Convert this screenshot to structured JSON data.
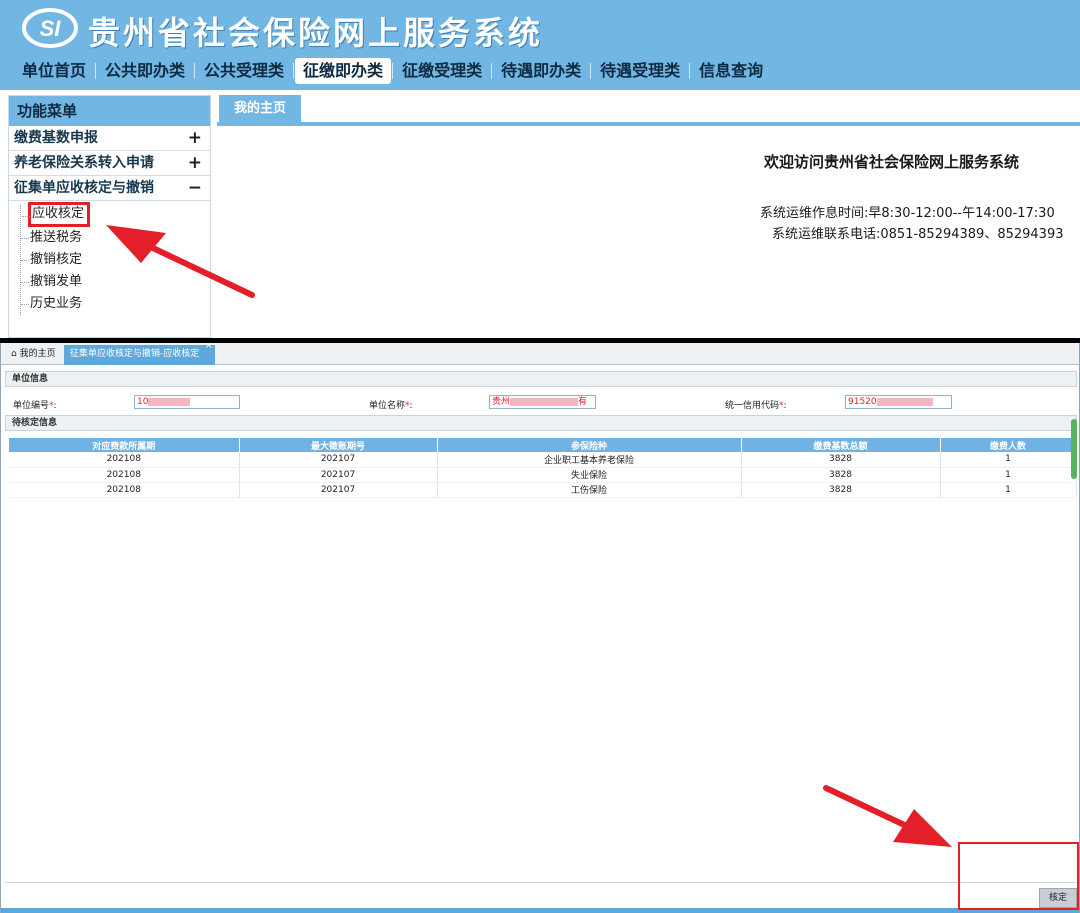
{
  "top": {
    "logo_text": "SI",
    "system_title": "贵州省社会保险网上服务系统",
    "nav": [
      {
        "label": "单位首页",
        "active": false
      },
      {
        "label": "公共即办类",
        "active": false
      },
      {
        "label": "公共受理类",
        "active": false
      },
      {
        "label": "征缴即办类",
        "active": true
      },
      {
        "label": "征缴受理类",
        "active": false
      },
      {
        "label": "待遇即办类",
        "active": false
      },
      {
        "label": "待遇受理类",
        "active": false
      },
      {
        "label": "信息查询",
        "active": false
      }
    ],
    "menu_title": "功能菜单",
    "menu_groups": [
      {
        "label": "缴费基数申报",
        "sign": "+"
      },
      {
        "label": "养老保险关系转入申请",
        "sign": "+"
      },
      {
        "label": "征集单应收核定与撤销",
        "sign": "−"
      }
    ],
    "sub_items": [
      "应收核定",
      "推送税务",
      "撤销核定",
      "撤销发单",
      "历史业务"
    ],
    "home_tab": "我的主页",
    "welcome": "欢迎访问贵州省社会保险网上服务系统",
    "hours": "系统运维作息时间:早8:30-12:00--午14:00-17:30",
    "phone": "系统运维联系电话:0851-85294389、85294393"
  },
  "bottom": {
    "tabs": [
      {
        "label": "我的主页",
        "icon": "home-icon"
      },
      {
        "label": "征集单应收核定与撤销-应收核定",
        "close": "×"
      }
    ],
    "unit_section": "单位信息",
    "fields": [
      {
        "label": "单位编号",
        "required": "*",
        "colon": ":",
        "value": "10"
      },
      {
        "label": "单位名称",
        "required": "*",
        "colon": ":",
        "value_prefix": "贵州",
        "value_suffix": "有"
      },
      {
        "label": "统一信用代码",
        "required": "*",
        "colon": ":",
        "value": "91520"
      }
    ],
    "pending_section": "待核定信息",
    "columns": [
      "对应费款所属期",
      "最大徵账期号",
      "参保险种",
      "缴费基数总额",
      "缴费人数"
    ],
    "rows": [
      [
        "202108",
        "202107",
        "企业职工基本养老保险",
        "3828",
        "1"
      ],
      [
        "202108",
        "202107",
        "失业保险",
        "3828",
        "1"
      ],
      [
        "202108",
        "202107",
        "工伤保险",
        "3828",
        "1"
      ]
    ],
    "confirm_button": "核定"
  },
  "colors": {
    "header_blue": "#72b6e4",
    "tab_blue": "#5fa8dc",
    "annotation_red": "#e3202a",
    "scrollbar_green": "#58b25e"
  }
}
